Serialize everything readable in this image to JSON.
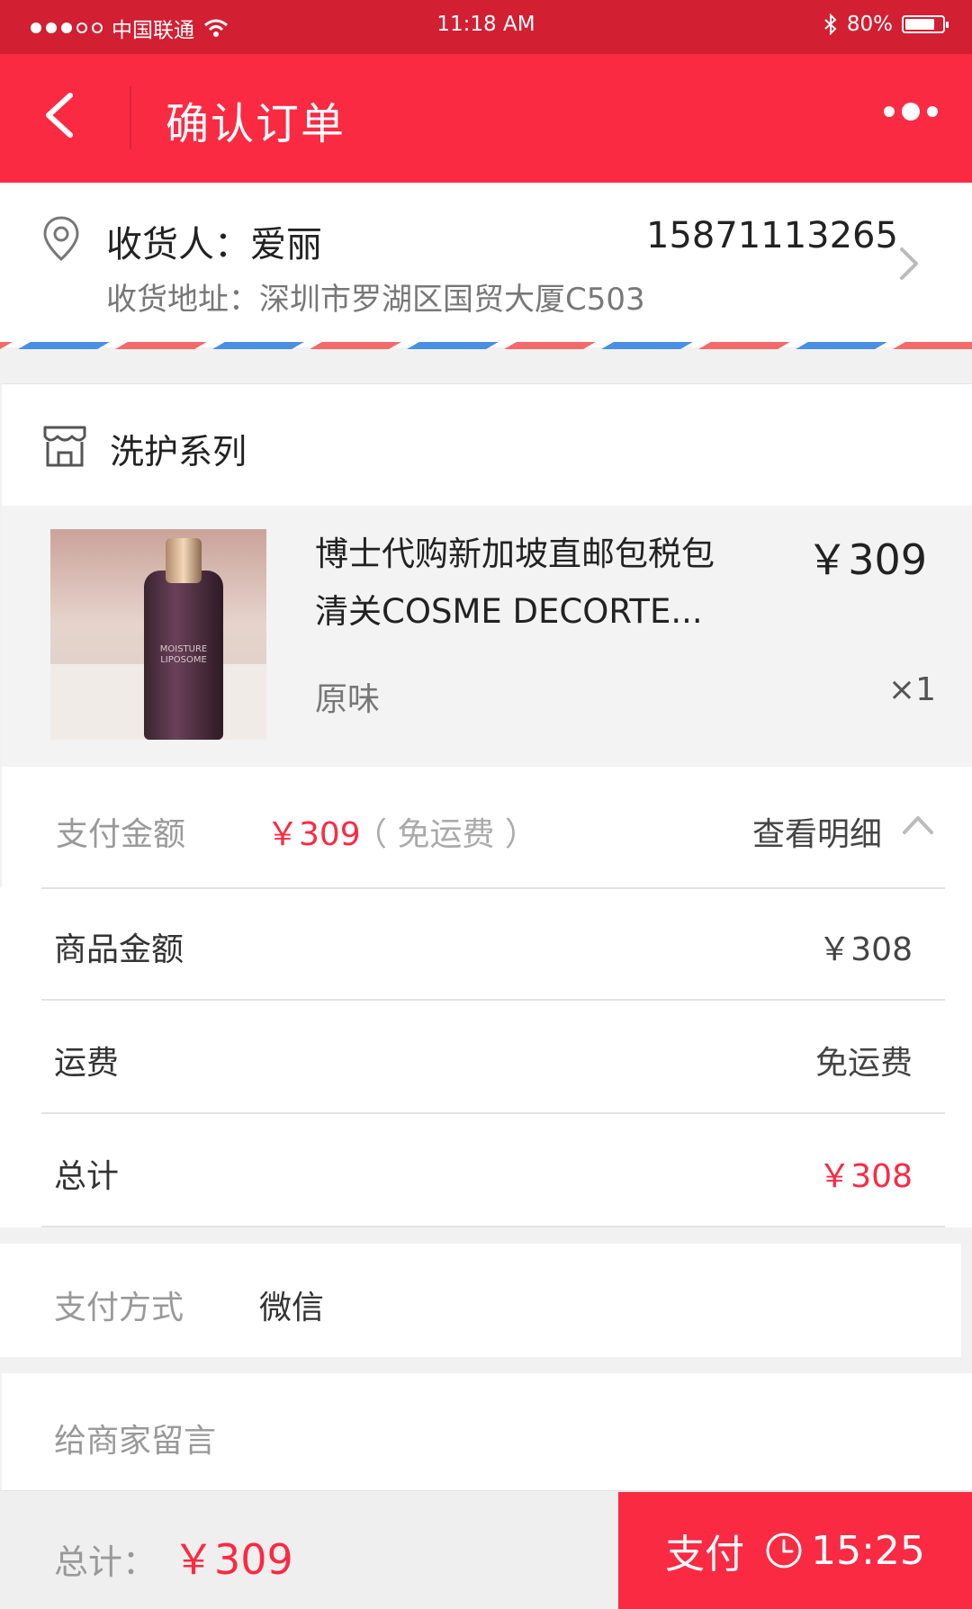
{
  "status_bar": {
    "carrier": "中国联通",
    "time": "11:18 AM",
    "battery": "80%",
    "battery_level": 0.8
  },
  "nav": {
    "title": "确认订单"
  },
  "address": {
    "recipient": "收货人：爱丽",
    "phone": "15871113265",
    "address": "收货地址：深圳市罗湖区国贸大厦C503"
  },
  "store": {
    "name": "洗护系列"
  },
  "product": {
    "title": "博士代购新加坡直邮包税包清关COSME DECORTE...",
    "price": "￥309",
    "variant": "原味",
    "quantity": "×1",
    "image_text": "MOISTURE LIPOSOME"
  },
  "payment_summary": {
    "label": "支付金额",
    "amount": "￥309",
    "shipping_note": "（ 免运费 ）",
    "detail_label": "查看明细"
  },
  "breakdown": [
    {
      "label": "商品金额",
      "value": "￥308"
    },
    {
      "label": "运费",
      "value": "免运费"
    },
    {
      "label": "总计",
      "value": "￥308"
    }
  ],
  "pay_method": {
    "label": "支付方式",
    "value": "微信"
  },
  "message": {
    "placeholder": "给商家留言"
  },
  "footer": {
    "total_label": "总计：",
    "total_amount": "￥309",
    "pay_label": "支付",
    "countdown": "15:25"
  },
  "colors": {
    "accent": "#fa2a43",
    "status_bar": "#d21f32"
  }
}
